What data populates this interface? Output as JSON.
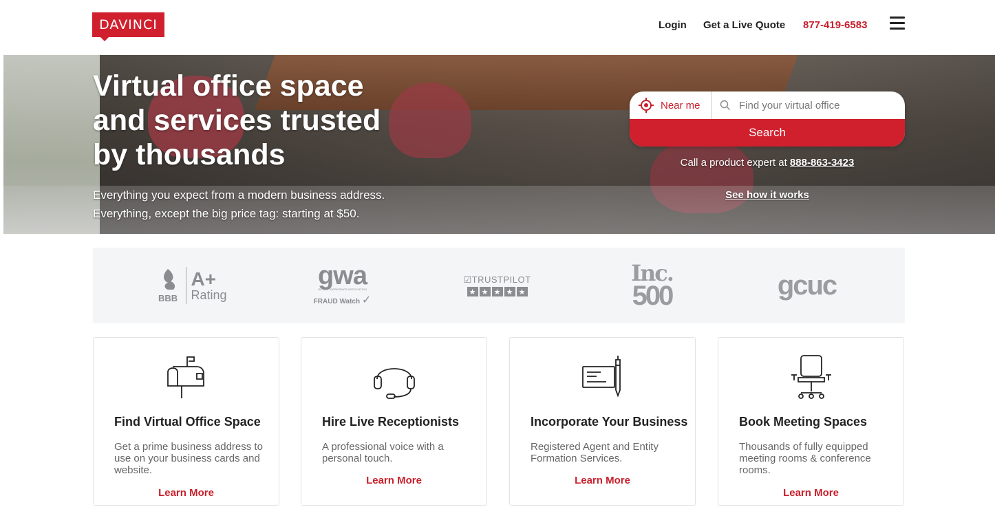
{
  "header": {
    "logo": "DAVINCI",
    "nav": {
      "login": "Login",
      "quote": "Get a Live Quote",
      "phone": "877-419-6583"
    },
    "menu_icon": "hamburger-menu-icon"
  },
  "hero": {
    "title": "Virtual office space and services trusted by thousands",
    "subtitle_line1": "Everything you expect from a modern business address.",
    "subtitle_line2": "Everything, except the big price tag: starting at $50.",
    "near_me": "Near me",
    "search_placeholder": "Find your virtual office",
    "search_button": "Search",
    "call_prefix": "Call a product expert at",
    "call_number": "888-863-3423",
    "how_it_works": "See how it works"
  },
  "badges": {
    "bbb_mark": "BBB",
    "bbb_grade": "A+",
    "bbb_rating": "Rating",
    "gwa_logo": "gwa",
    "gwa_sub": "GLOBAL WORKSPACE ASSOCIATION",
    "gwa_fraud": "FRAUD Watch",
    "trustpilot": "TRUSTPILOT",
    "inc_line1": "Inc.",
    "inc_line2": "500",
    "gcuc": "gcuc"
  },
  "cards": [
    {
      "icon": "mailbox-icon",
      "title": "Find Virtual Office Space",
      "desc": "Get a prime business address to use on your business cards and website.",
      "link": "Learn More"
    },
    {
      "icon": "headset-icon",
      "title": "Hire Live Receptionists",
      "desc": "A professional voice with a personal touch.",
      "link": "Learn More"
    },
    {
      "icon": "check-pen-icon",
      "title": "Incorporate Your Business",
      "desc": "Registered Agent and Entity Formation Services.",
      "link": "Learn More"
    },
    {
      "icon": "office-chair-icon",
      "title": "Book Meeting Spaces",
      "desc": "Thousands of fully equipped meeting rooms & conference rooms.",
      "link": "Learn More"
    }
  ],
  "colors": {
    "brand_red": "#d0202e",
    "link_red": "#c8202c",
    "badge_bg": "#f4f5f7",
    "badge_gray": "#8a8c8f"
  }
}
